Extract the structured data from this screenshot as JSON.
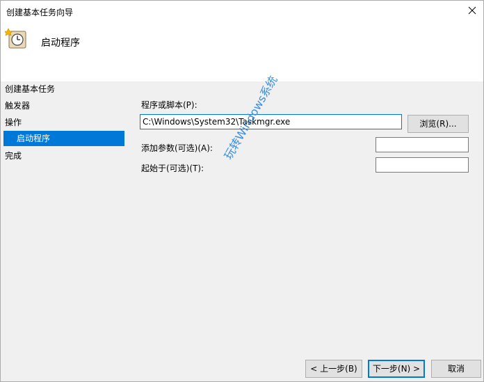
{
  "window": {
    "title": "创建基本任务向导"
  },
  "header": {
    "heading": "启动程序",
    "icon": "task-scheduler-clock-icon"
  },
  "nav": {
    "items": [
      {
        "label": "创建基本任务"
      },
      {
        "label": "触发器"
      },
      {
        "label": "操作"
      },
      {
        "label": "启动程序"
      },
      {
        "label": "完成"
      }
    ]
  },
  "form": {
    "program_label": "程序或脚本(P):",
    "program_value": "C:\\Windows\\System32\\Taskmgr.exe",
    "browse_label": "浏览(R)...",
    "args_label": "添加参数(可选)(A):",
    "args_value": "",
    "startin_label": "起始于(可选)(T):",
    "startin_value": ""
  },
  "footer": {
    "back_label": "< 上一步(B)",
    "next_label": "下一步(N) >",
    "cancel_label": "取消"
  },
  "watermark": "玩转Windows系统",
  "colors": {
    "selection": "#0078d7",
    "focus_border": "#0078d7"
  }
}
